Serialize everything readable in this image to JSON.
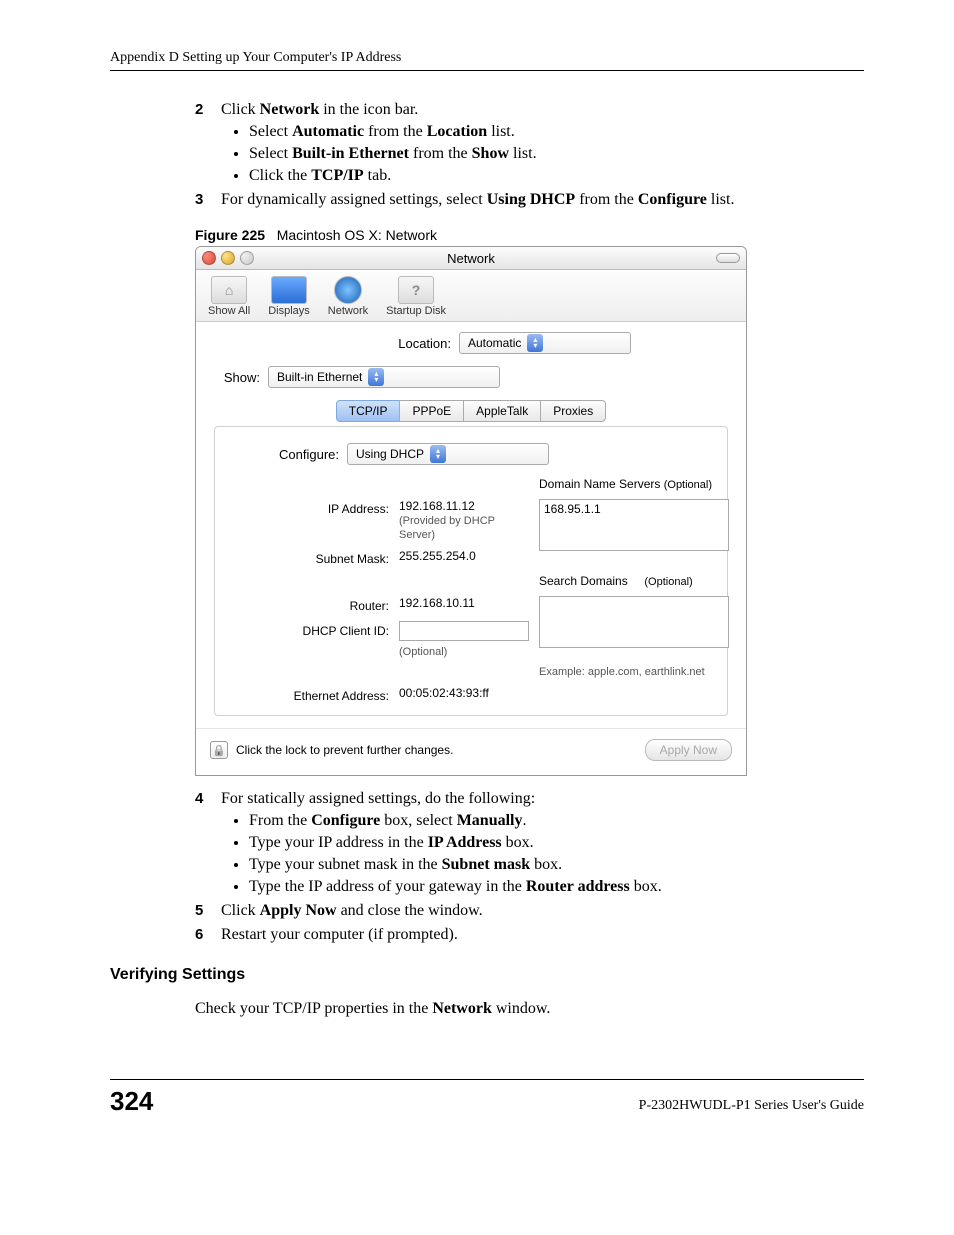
{
  "header": "Appendix D Setting up Your Computer's IP Address",
  "steps_a": {
    "s2": {
      "num": "2",
      "lead1": "Click ",
      "b1": "Network",
      "tail1": " in the icon bar.",
      "bullets": [
        {
          "pre": "Select ",
          "b": "Automatic",
          "mid": " from the ",
          "b2": "Location",
          "post": " list."
        },
        {
          "pre": "Select ",
          "b": "Built-in Ethernet",
          "mid": " from the ",
          "b2": "Show",
          "post": " list."
        },
        {
          "pre": "Click the ",
          "b": "TCP/IP",
          "mid": "",
          "b2": "",
          "post": " tab."
        }
      ]
    },
    "s3": {
      "num": "3",
      "pre": "For dynamically assigned settings, select ",
      "b1": "Using DHCP",
      "mid": " from the ",
      "b2": "Configure",
      "post": " list."
    }
  },
  "figure": {
    "label": "Figure 225",
    "caption": "Macintosh OS X: Network"
  },
  "osx": {
    "title": "Network",
    "toolbar": [
      "Show All",
      "Displays",
      "Network",
      "Startup Disk"
    ],
    "location_label": "Location:",
    "location_value": "Automatic",
    "show_label": "Show:",
    "show_value": "Built-in Ethernet",
    "tabs": [
      "TCP/IP",
      "PPPoE",
      "AppleTalk",
      "Proxies"
    ],
    "configure_label": "Configure:",
    "configure_value": "Using DHCP",
    "dns_label": "Domain Name Servers",
    "dns_opt": "(Optional)",
    "dns_value": "168.95.1.1",
    "ip_label": "IP Address:",
    "ip_value": "192.168.11.12",
    "ip_hint": "(Provided by DHCP Server)",
    "subnet_label": "Subnet Mask:",
    "subnet_value": "255.255.254.0",
    "search_label": "Search Domains",
    "search_opt": "(Optional)",
    "router_label": "Router:",
    "router_value": "192.168.10.11",
    "dhcp_label": "DHCP Client ID:",
    "dhcp_hint": "(Optional)",
    "example": "Example: apple.com, earthlink.net",
    "eth_label": "Ethernet Address:",
    "eth_value": "00:05:02:43:93:ff",
    "lock_text": "Click the lock to prevent further changes.",
    "apply": "Apply Now"
  },
  "steps_b": {
    "s4": {
      "num": "4",
      "lead": "For statically assigned settings, do the following:",
      "bullets": [
        {
          "pre": "From the ",
          "b": "Configure",
          "mid": " box, select ",
          "b2": "Manually",
          "post": "."
        },
        {
          "pre": "Type your IP address in the ",
          "b": "IP Address",
          "mid": "",
          "b2": "",
          "post": " box."
        },
        {
          "pre": "Type your subnet mask in the ",
          "b": "Subnet mask",
          "mid": "",
          "b2": "",
          "post": " box."
        },
        {
          "pre": "Type the IP address of your gateway in the ",
          "b": "Router address",
          "mid": "",
          "b2": "",
          "post": " box."
        }
      ]
    },
    "s5": {
      "num": "5",
      "pre": "Click ",
      "b": "Apply Now",
      "post": " and close the window."
    },
    "s6": {
      "num": "6",
      "text": "Restart your computer (if prompted)."
    }
  },
  "section_heading": "Verifying Settings",
  "verify_line": {
    "pre": "Check your TCP/IP properties in the ",
    "b": "Network",
    "post": " window."
  },
  "footer": {
    "page": "324",
    "guide": "P-2302HWUDL-P1 Series User's Guide"
  }
}
